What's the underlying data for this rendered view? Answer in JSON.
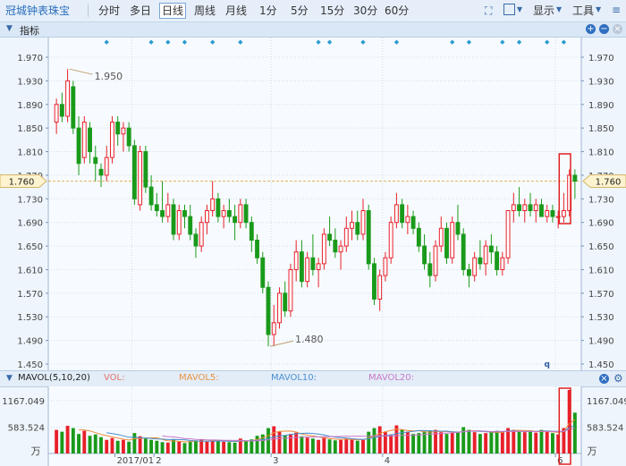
{
  "toolbar": {
    "title": "冠城钟表珠宝",
    "periods": [
      "分时",
      "多日",
      "日线",
      "周线",
      "月线",
      "1分",
      "5分",
      "15分",
      "30分",
      "60分"
    ],
    "selected": "日线",
    "display_label": "显示",
    "tools_label": "工具"
  },
  "indicator_bar": {
    "label": "指标"
  },
  "volume_bar": {
    "name": "MAVOL(5,10,20)",
    "vol": "VOL:",
    "ma5": "MAVOL5:",
    "ma10": "MAVOL10:",
    "ma20": "MAVOL20:"
  },
  "colors": {
    "up": "#e8202a",
    "down": "#1a9a1a",
    "ma5": "#f08c3a",
    "ma10": "#4a8fd0",
    "ma20": "#c878c8",
    "accent": "#2a6ebd"
  },
  "chart_data": {
    "type": "candlestick",
    "price_axis": {
      "ticks": [
        "1.970",
        "1.930",
        "1.890",
        "1.850",
        "1.810",
        "1.770",
        "1.730",
        "1.690",
        "1.650",
        "1.610",
        "1.570",
        "1.530",
        "1.490",
        "1.450"
      ],
      "ylim": [
        1.45,
        1.97
      ],
      "current_price": "1.760",
      "grid": true
    },
    "annotations": {
      "high": "1.950",
      "low": "1.480",
      "marker": "q"
    },
    "x_labels": [
      "2017/01",
      "2",
      "3",
      "4",
      "6"
    ],
    "ohlc": [
      [
        1.86,
        1.9,
        1.84,
        1.89
      ],
      [
        1.89,
        1.91,
        1.86,
        1.87
      ],
      [
        1.87,
        1.95,
        1.86,
        1.93
      ],
      [
        1.92,
        1.93,
        1.84,
        1.85
      ],
      [
        1.85,
        1.87,
        1.77,
        1.79
      ],
      [
        1.8,
        1.87,
        1.79,
        1.86
      ],
      [
        1.85,
        1.86,
        1.79,
        1.81
      ],
      [
        1.8,
        1.82,
        1.76,
        1.79
      ],
      [
        1.78,
        1.79,
        1.75,
        1.77
      ],
      [
        1.77,
        1.82,
        1.76,
        1.8
      ],
      [
        1.8,
        1.87,
        1.79,
        1.86
      ],
      [
        1.86,
        1.87,
        1.82,
        1.84
      ],
      [
        1.84,
        1.86,
        1.81,
        1.85
      ],
      [
        1.85,
        1.86,
        1.81,
        1.82
      ],
      [
        1.82,
        1.83,
        1.72,
        1.73
      ],
      [
        1.72,
        1.82,
        1.71,
        1.81
      ],
      [
        1.81,
        1.82,
        1.74,
        1.75
      ],
      [
        1.75,
        1.77,
        1.71,
        1.72
      ],
      [
        1.72,
        1.74,
        1.7,
        1.71
      ],
      [
        1.71,
        1.76,
        1.69,
        1.7
      ],
      [
        1.7,
        1.74,
        1.69,
        1.72
      ],
      [
        1.72,
        1.73,
        1.66,
        1.67
      ],
      [
        1.67,
        1.72,
        1.66,
        1.71
      ],
      [
        1.71,
        1.72,
        1.68,
        1.7
      ],
      [
        1.7,
        1.72,
        1.66,
        1.67
      ],
      [
        1.67,
        1.68,
        1.63,
        1.65
      ],
      [
        1.65,
        1.7,
        1.64,
        1.69
      ],
      [
        1.69,
        1.72,
        1.67,
        1.71
      ],
      [
        1.71,
        1.76,
        1.7,
        1.73
      ],
      [
        1.73,
        1.74,
        1.69,
        1.7
      ],
      [
        1.7,
        1.72,
        1.68,
        1.71
      ],
      [
        1.71,
        1.73,
        1.69,
        1.7
      ],
      [
        1.7,
        1.72,
        1.66,
        1.69
      ],
      [
        1.69,
        1.73,
        1.68,
        1.72
      ],
      [
        1.72,
        1.73,
        1.68,
        1.69
      ],
      [
        1.69,
        1.7,
        1.64,
        1.66
      ],
      [
        1.66,
        1.67,
        1.62,
        1.63
      ],
      [
        1.63,
        1.64,
        1.57,
        1.58
      ],
      [
        1.58,
        1.59,
        1.48,
        1.5
      ],
      [
        1.5,
        1.55,
        1.48,
        1.52
      ],
      [
        1.52,
        1.58,
        1.51,
        1.57
      ],
      [
        1.57,
        1.59,
        1.53,
        1.54
      ],
      [
        1.54,
        1.62,
        1.53,
        1.61
      ],
      [
        1.61,
        1.66,
        1.59,
        1.64
      ],
      [
        1.64,
        1.66,
        1.58,
        1.59
      ],
      [
        1.59,
        1.64,
        1.58,
        1.63
      ],
      [
        1.63,
        1.67,
        1.6,
        1.61
      ],
      [
        1.61,
        1.63,
        1.58,
        1.62
      ],
      [
        1.62,
        1.68,
        1.61,
        1.67
      ],
      [
        1.67,
        1.7,
        1.65,
        1.66
      ],
      [
        1.66,
        1.68,
        1.63,
        1.64
      ],
      [
        1.64,
        1.66,
        1.61,
        1.65
      ],
      [
        1.65,
        1.7,
        1.64,
        1.68
      ],
      [
        1.68,
        1.71,
        1.66,
        1.69
      ],
      [
        1.69,
        1.71,
        1.66,
        1.67
      ],
      [
        1.67,
        1.73,
        1.66,
        1.71
      ],
      [
        1.71,
        1.72,
        1.61,
        1.62
      ],
      [
        1.62,
        1.63,
        1.55,
        1.56
      ],
      [
        1.56,
        1.61,
        1.54,
        1.6
      ],
      [
        1.6,
        1.64,
        1.59,
        1.63
      ],
      [
        1.63,
        1.7,
        1.62,
        1.69
      ],
      [
        1.69,
        1.74,
        1.68,
        1.72
      ],
      [
        1.72,
        1.73,
        1.68,
        1.69
      ],
      [
        1.69,
        1.72,
        1.67,
        1.7
      ],
      [
        1.7,
        1.71,
        1.67,
        1.68
      ],
      [
        1.68,
        1.69,
        1.64,
        1.65
      ],
      [
        1.65,
        1.67,
        1.61,
        1.62
      ],
      [
        1.62,
        1.64,
        1.58,
        1.6
      ],
      [
        1.6,
        1.66,
        1.59,
        1.65
      ],
      [
        1.65,
        1.7,
        1.64,
        1.68
      ],
      [
        1.68,
        1.69,
        1.62,
        1.63
      ],
      [
        1.63,
        1.7,
        1.62,
        1.69
      ],
      [
        1.69,
        1.72,
        1.66,
        1.67
      ],
      [
        1.67,
        1.68,
        1.6,
        1.61
      ],
      [
        1.61,
        1.62,
        1.58,
        1.6
      ],
      [
        1.6,
        1.64,
        1.59,
        1.63
      ],
      [
        1.63,
        1.66,
        1.61,
        1.62
      ],
      [
        1.62,
        1.66,
        1.6,
        1.65
      ],
      [
        1.65,
        1.67,
        1.62,
        1.64
      ],
      [
        1.64,
        1.65,
        1.6,
        1.61
      ],
      [
        1.61,
        1.64,
        1.6,
        1.63
      ],
      [
        1.63,
        1.7,
        1.62,
        1.71
      ],
      [
        1.71,
        1.74,
        1.69,
        1.72
      ],
      [
        1.72,
        1.75,
        1.7,
        1.71
      ],
      [
        1.71,
        1.73,
        1.69,
        1.72
      ],
      [
        1.72,
        1.74,
        1.7,
        1.71
      ],
      [
        1.71,
        1.73,
        1.69,
        1.72
      ],
      [
        1.72,
        1.73,
        1.7,
        1.7
      ],
      [
        1.7,
        1.72,
        1.69,
        1.71
      ],
      [
        1.71,
        1.72,
        1.69,
        1.7
      ],
      [
        1.7,
        1.71,
        1.68,
        1.7
      ],
      [
        1.7,
        1.74,
        1.69,
        1.71
      ],
      [
        1.71,
        1.78,
        1.7,
        1.77
      ],
      [
        1.77,
        1.78,
        1.73,
        1.76
      ]
    ],
    "volume_axis": {
      "ticks": [
        "1167.049",
        "583.524"
      ],
      "unit": "万",
      "ylim": [
        0,
        1400
      ]
    },
    "volume": [
      520,
      480,
      610,
      560,
      430,
      500,
      390,
      420,
      360,
      300,
      340,
      280,
      300,
      260,
      450,
      380,
      330,
      300,
      280,
      250,
      240,
      310,
      260,
      230,
      270,
      290,
      310,
      260,
      300,
      280,
      260,
      250,
      240,
      330,
      280,
      310,
      390,
      420,
      560,
      600,
      480,
      400,
      430,
      460,
      380,
      350,
      330,
      300,
      360,
      310,
      290,
      300,
      330,
      310,
      280,
      300,
      480,
      560,
      600,
      470,
      420,
      620,
      530,
      480,
      430,
      450,
      490,
      510,
      520,
      470,
      430,
      460,
      480,
      580,
      520,
      470,
      430,
      450,
      470,
      500,
      480,
      560,
      520,
      490,
      470,
      480,
      460,
      520,
      480,
      450,
      420,
      560,
      1400,
      900
    ]
  }
}
